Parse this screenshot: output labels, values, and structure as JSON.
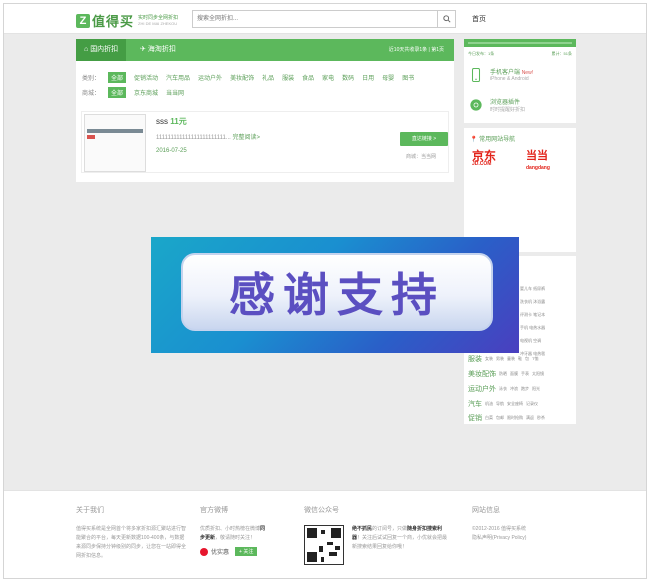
{
  "header": {
    "logo_letter": "Z",
    "logo_text": "值得买",
    "logo_slogan": "实时同步全网折扣",
    "logo_slogan_en": "ZHI DE MAI ZHEKOU",
    "search_placeholder": "搜索全网折扣...",
    "nav_home": "首页"
  },
  "main": {
    "tabs": [
      {
        "label": "国内折扣",
        "icon": "home-icon"
      },
      {
        "label": "海淘折扣",
        "icon": "plane-icon"
      }
    ],
    "page_info": "近10天共收录1条 | 第1页",
    "filters": {
      "category_label": "类别：",
      "categories": [
        "全部",
        "促销活动",
        "汽车用品",
        "运动户外",
        "美妆配饰",
        "礼品",
        "服装",
        "食品",
        "家电",
        "数码",
        "日用",
        "母婴",
        "图书"
      ],
      "mall_label": "商城：",
      "malls": [
        "全部",
        "京东商城",
        "当当网"
      ]
    },
    "product": {
      "title": "sss",
      "price": "11元",
      "desc": "111111111111111111111111...",
      "more": "完整阅读>",
      "date": "2016-07-25",
      "button": "直达链接 >",
      "mall": "商城：当当网"
    }
  },
  "sidebar": {
    "stats": {
      "today": "今日发布：1条",
      "total": "累计：51条"
    },
    "apps": [
      {
        "name": "手机客户端",
        "badge": "New!",
        "sub": "iPhone & Android",
        "icon": "phone-icon"
      },
      {
        "name": "浏览器插件",
        "badge": "",
        "sub": "时时提醒好折扣",
        "icon": "chrome-icon"
      }
    ],
    "sites_title": "常用网站导航",
    "sites": [
      {
        "name": "京东",
        "sub": "JD.COM"
      },
      {
        "name": "当当",
        "sub": "dangdang"
      }
    ],
    "category_rows": [
      {
        "name": "服装",
        "items": [
          "女装",
          "男装",
          "童装",
          "鞋",
          "包",
          "T恤"
        ]
      },
      {
        "name": "美妆配饰",
        "items": [
          "防晒",
          "面膜",
          "手表",
          "太阳镜"
        ]
      },
      {
        "name": "运动户外",
        "items": [
          "泳衣",
          "冲浪",
          "跑步",
          "阳光"
        ]
      },
      {
        "name": "汽车",
        "items": [
          "机油",
          "导航",
          "安全座椅",
          "记录仪"
        ]
      },
      {
        "name": "促销",
        "items": [
          "白菜",
          "包邮",
          "限时抢购",
          "满返",
          "秒杀"
        ]
      }
    ],
    "tag_snippets": [
      "婴儿车",
      "纸尿裤",
      "洗衣机",
      "沐浴露",
      "评测卡",
      "笔记本",
      "手机",
      "电热水器",
      "电视机",
      "空调",
      "冲牙器",
      "电热毯"
    ]
  },
  "banner": {
    "text": "感谢支持"
  },
  "footer": {
    "about": {
      "title": "关于我们",
      "text": "值得买系统是全网首个将多家折扣源汇聚站进行智能聚合的平台，每天更新数据100-400条，与数据来源同步保持分钟级别的同步，让您在一站即得全网折扣信息。"
    },
    "weibo": {
      "title": "官方微博",
      "text_pre": "优质折扣、小时热榜在微博",
      "text_bold": "同步更新",
      "text_post": "，敬请随时关注！",
      "account": "优实惠",
      "follow": "+ 关注"
    },
    "wechat": {
      "title": "微信公众号",
      "text_bold": "绝不抓民",
      "text_pre": "的订阅号，只做",
      "text_bold2": "随身折扣搜索利器",
      "text_post": "！关注后试试回复一个商，小优就会把最新搜索结果回复给你哦！"
    },
    "site": {
      "title": "网站信息",
      "copyright": "©2012-2016 值得买系统",
      "privacy": "隐私声明(Privacy Policy)"
    }
  },
  "colors": {
    "brand_green": "#5cb85c",
    "brand_dark_green": "#449d44",
    "price_red": "#e2231a"
  }
}
